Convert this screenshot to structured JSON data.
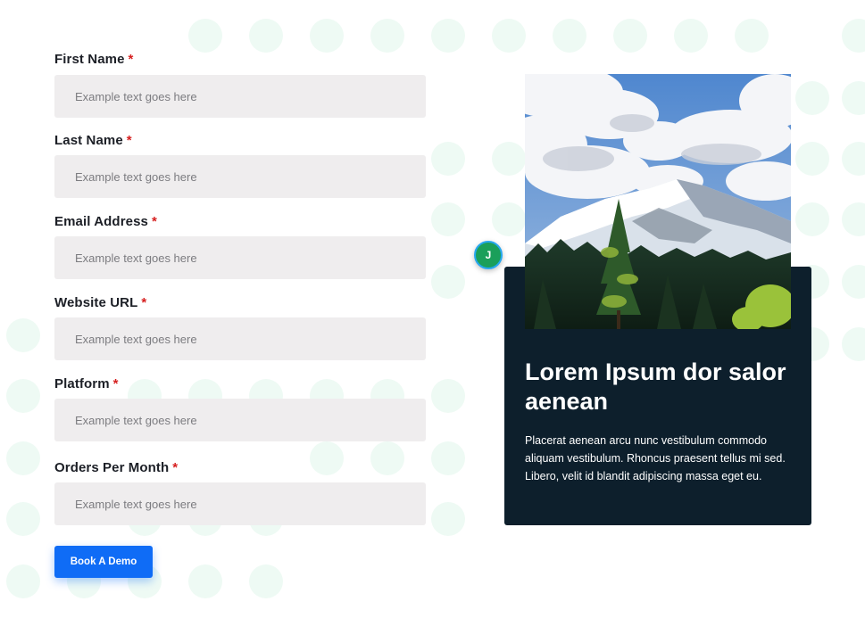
{
  "form": {
    "fields": [
      {
        "label": "First Name",
        "required_mark": "*",
        "placeholder": "Example text goes here"
      },
      {
        "label": "Last Name",
        "required_mark": "*",
        "placeholder": "Example text goes here"
      },
      {
        "label": "Email Address",
        "required_mark": "*",
        "placeholder": "Example text goes here"
      },
      {
        "label": "Website URL",
        "required_mark": "*",
        "placeholder": "Example text goes here"
      },
      {
        "label": "Platform",
        "required_mark": "*",
        "placeholder": "Example text goes here"
      },
      {
        "label": "Orders Per Month",
        "required_mark": "*",
        "placeholder": "Example text goes here"
      }
    ],
    "submit_label": "Book A Demo"
  },
  "card": {
    "title": "Lorem Ipsum dor salor aenean",
    "body": "Placerat aenean arcu nunc vestibulum commodo aliquam vestibulum. Rhoncus praesent tellus mi sed. Libero, velit id blandit adipiscing massa eget eu."
  },
  "avatar": {
    "initial": "J"
  },
  "colors": {
    "accent": "#0f6cf6",
    "card_bg": "#0d1f2c",
    "input_bg": "#efedee",
    "required": "#d61f1f",
    "dots": "#eefaf4"
  },
  "icons": {
    "photo": "mountain-landscape-image",
    "avatar": "user-avatar-icon"
  }
}
